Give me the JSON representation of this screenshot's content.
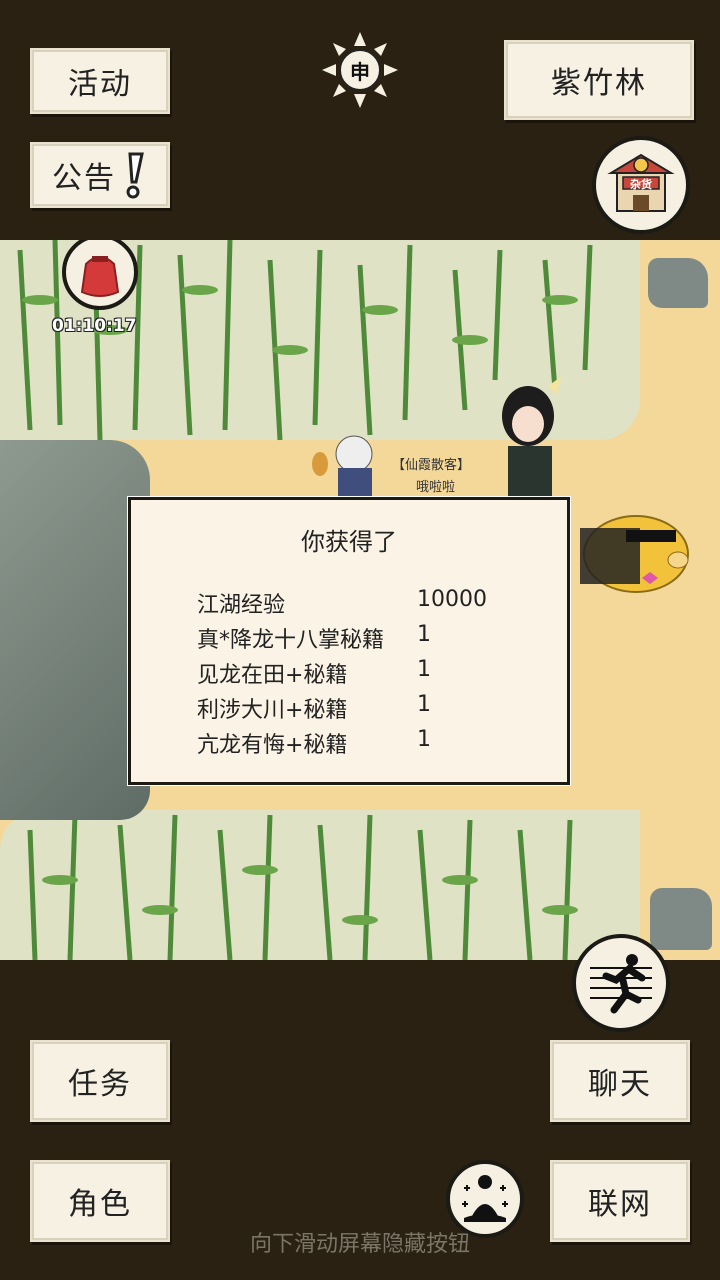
{
  "top": {
    "activity_label": "活动",
    "notice_label": "公告",
    "location_label": "紫竹林",
    "time_glyph": "申",
    "shop_label": "杂货"
  },
  "map": {
    "timer": "01:10:17",
    "npc_title": "【仙霞散客】",
    "npc_name": "哦啦啦"
  },
  "reward": {
    "title": "你获得了",
    "items": [
      {
        "name": "江湖经验",
        "qty": "10000"
      },
      {
        "name": "真*降龙十八掌秘籍",
        "qty": "1"
      },
      {
        "name": "见龙在田+秘籍",
        "qty": "1"
      },
      {
        "name": "利涉大川+秘籍",
        "qty": "1"
      },
      {
        "name": "亢龙有悔+秘籍",
        "qty": "1"
      }
    ]
  },
  "bottom": {
    "task_label": "任务",
    "chat_label": "聊天",
    "role_label": "角色",
    "network_label": "联网",
    "hint": "向下滑动屏幕隐藏按钮"
  },
  "colors": {
    "background": "#2a2112",
    "button_bg": "#f6f1e3",
    "sand": "#f3d89a",
    "bamboo": "#4f8a3a"
  }
}
